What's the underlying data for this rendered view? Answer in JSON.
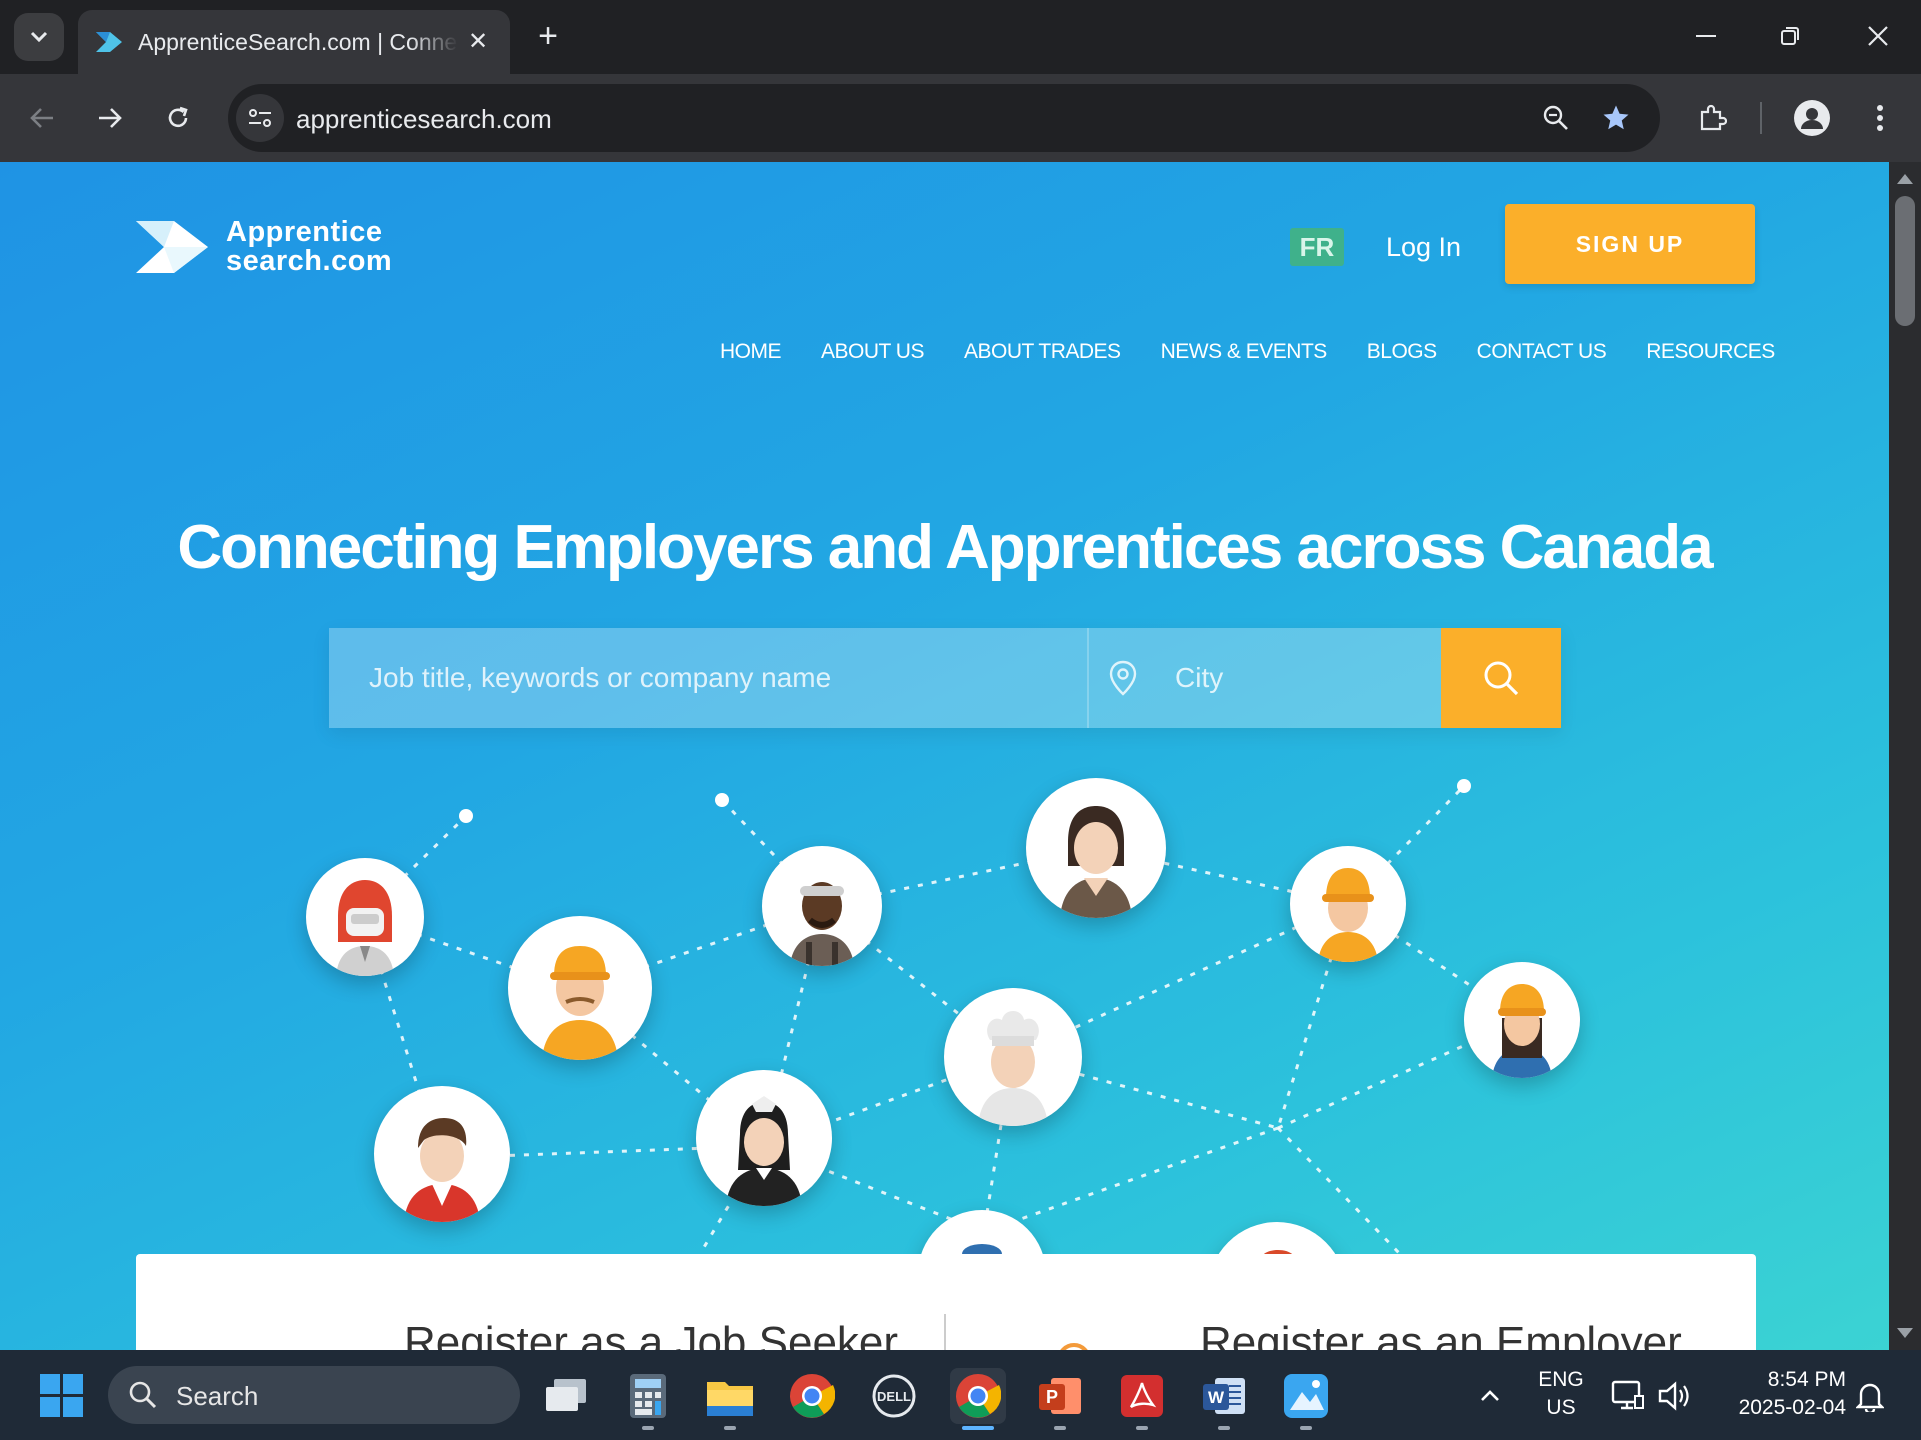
{
  "browser": {
    "tab_title": "ApprenticeSearch.com | Connecting Employers and Apprentices across Canada",
    "close_symbol": "✕",
    "new_tab_symbol": "+",
    "url": "apprenticesearch.com"
  },
  "site": {
    "logo_line1": "Apprentice",
    "logo_line2": "search.com",
    "lang_toggle": "FR",
    "login": "Log In",
    "signup": "SIGN UP",
    "nav": [
      "HOME",
      "ABOUT US",
      "ABOUT TRADES",
      "NEWS & EVENTS",
      "BLOGS",
      "CONTACT US",
      "RESOURCES"
    ],
    "hero_title": "Connecting Employers and Apprentices across Canada",
    "search_placeholder": "Job title, keywords or company name",
    "city_placeholder": "City",
    "register_job_seeker": "Register as a Job Seeker",
    "register_employer": "Register as an Employer"
  },
  "colors": {
    "accent_orange": "#fbaf2a",
    "fr_green": "#3fb18b",
    "hero_blue": "#1f93e4",
    "hero_teal": "#3bd3d3"
  },
  "taskbar": {
    "search_label": "Search",
    "apps": [
      "task-view",
      "calculator",
      "file-explorer",
      "chrome",
      "dell",
      "chrome-active",
      "powerpoint",
      "acrobat",
      "word",
      "photos"
    ],
    "lang_line1": "ENG",
    "lang_line2": "US",
    "time": "8:54 PM",
    "date": "2025-02-04"
  }
}
